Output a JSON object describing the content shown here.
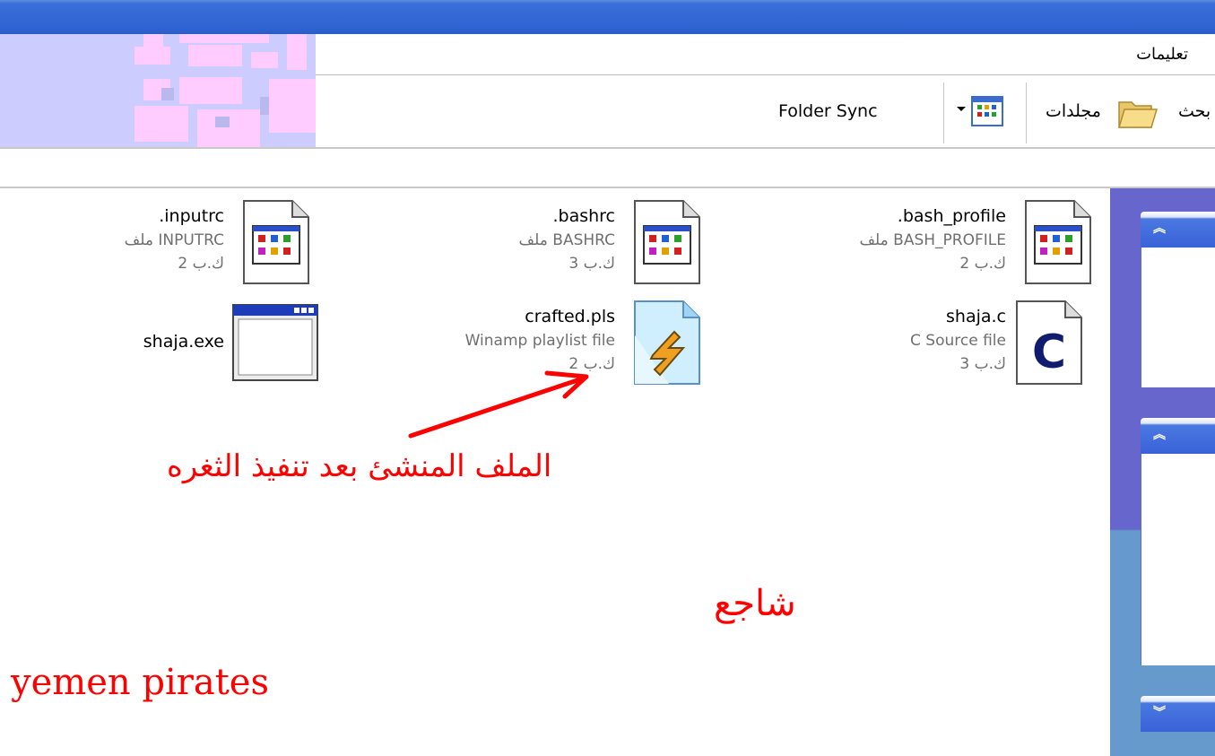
{
  "menu": {
    "help_label": "تعليمات"
  },
  "toolbar": {
    "folder_sync_label": "Folder Sync",
    "folders_label": "مجلدات",
    "search_label": "بحث"
  },
  "files": [
    {
      "name": ".bash_profile",
      "type": "ملف BASH_PROFILE",
      "size": "2 ك.ب",
      "icon": "settings-doc-icon"
    },
    {
      "name": ".bashrc",
      "type": "ملف BASHRC",
      "size": "3 ك.ب",
      "icon": "settings-doc-icon"
    },
    {
      "name": ".inputrc",
      "type": "ملف INPUTRC",
      "size": "2 ك.ب",
      "icon": "settings-doc-icon"
    },
    {
      "name": "shaja.c",
      "type": "C Source file",
      "size": "3 ك.ب",
      "icon": "c-source-icon"
    },
    {
      "name": "crafted.pls",
      "type": "Winamp playlist file",
      "size": "2 ك.ب",
      "icon": "winamp-playlist-icon"
    },
    {
      "name": "shaja.exe",
      "icon": "exe-window-icon"
    }
  ],
  "annotations": {
    "created_file_note": "الملف المنشئ بعد تنفيذ الثغره",
    "author_name": "شاجع",
    "group_name": "yemen pirates"
  },
  "colors": {
    "titlebar": "#2f64d2",
    "annotation": "#ff0000",
    "task_pane": "#6666cc"
  }
}
